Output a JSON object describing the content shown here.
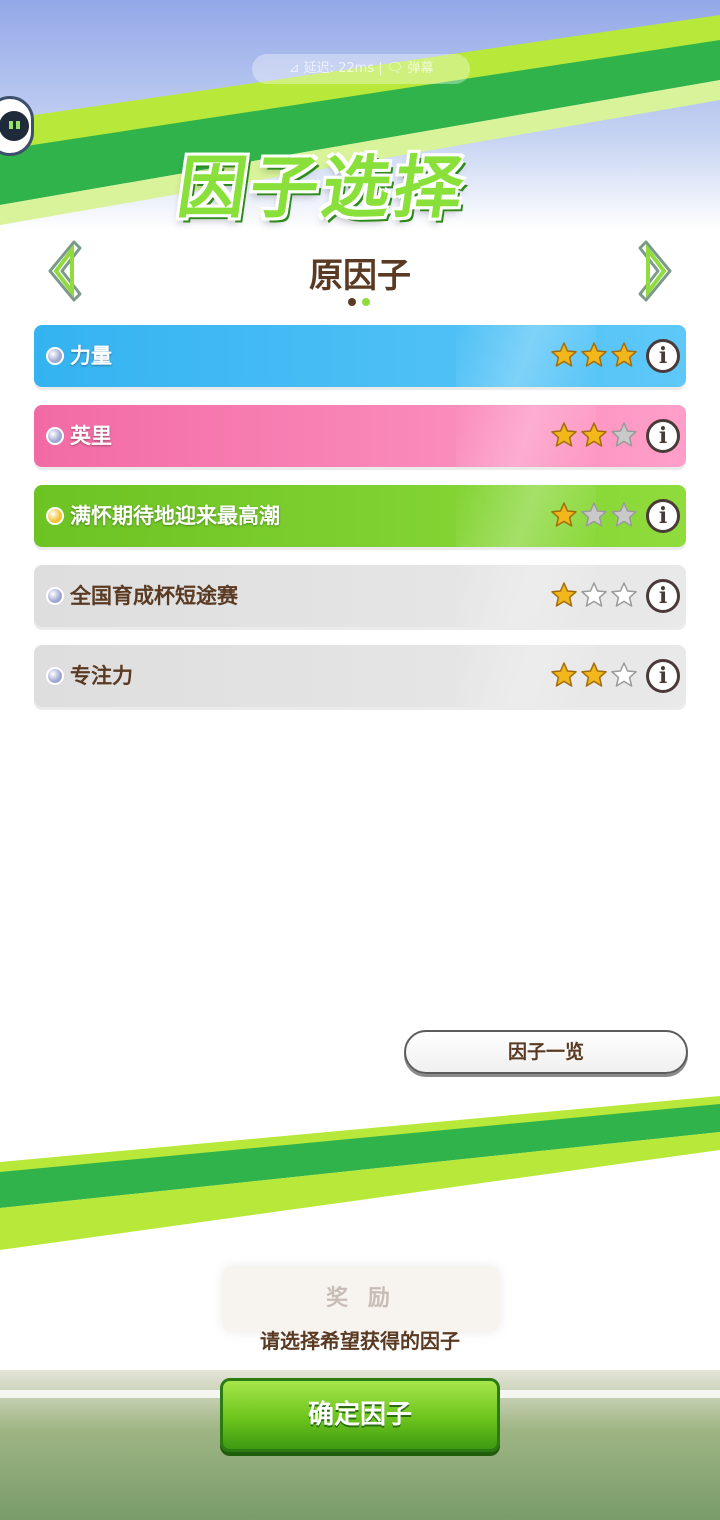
{
  "status_overlay": {
    "text": "⊿ 延迟: 22ms | 🗨 弹幕"
  },
  "header": {
    "title": "因子选择",
    "subtitle": "原因子",
    "prev_label": "previous-page",
    "next_label": "next-page",
    "page_indicator": {
      "current": 2,
      "total": 2
    }
  },
  "factors": [
    {
      "name": "力量",
      "stars": 3,
      "max_stars": 3,
      "bg_from": "#34b3f1",
      "bg_to": "#5ec8f8",
      "text_color": "#ffffff",
      "orb_color": "#9ea6d4"
    },
    {
      "name": "英里",
      "stars": 2,
      "max_stars": 3,
      "bg_from": "#f26aa4",
      "bg_to": "#ff9fc8",
      "text_color": "#ffffff",
      "orb_color": "#9ea6d4"
    },
    {
      "name": "满怀期待地迎来最高潮",
      "stars": 1,
      "max_stars": 3,
      "bg_from": "#6cc323",
      "bg_to": "#8fdc3c",
      "text_color": "#ffffff",
      "orb_color": "#f5c02a"
    },
    {
      "name": "全国育成杯短途赛",
      "stars": 1,
      "max_stars": 3,
      "bg_from": "#dedede",
      "bg_to": "#e9e9e9",
      "text_color": "#5a3a22",
      "orb_color": "#9ea6d4"
    },
    {
      "name": "专注力",
      "stars": 2,
      "max_stars": 3,
      "bg_from": "#dedede",
      "bg_to": "#e9e9e9",
      "text_color": "#5a3a22",
      "orb_color": "#9ea6d4"
    }
  ],
  "info_label": "i",
  "list_button": {
    "label": "因子一览"
  },
  "bottom": {
    "ghost_label": "奖 励",
    "prompt": "请选择希望获得的因子",
    "confirm_label": "确定因子"
  },
  "colors": {
    "accent_green": "#7ed12e",
    "text_brown": "#5a3a22",
    "star_gold": "#f2b71a",
    "star_empty_gray": "#b9b9b9"
  }
}
